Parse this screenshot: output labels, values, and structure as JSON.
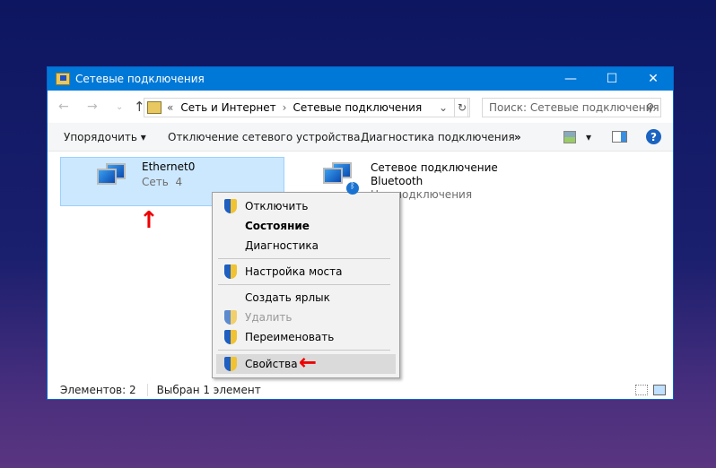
{
  "window": {
    "title": "Сетевые подключения",
    "minimize": "—",
    "maximize": "☐",
    "close": "✕"
  },
  "address": {
    "back": "←",
    "forward": "→",
    "recent": "⌄",
    "up": "↑",
    "overflow": "«",
    "crumbs": [
      "Сеть и Интернет",
      "Сетевые подключения"
    ],
    "sep": "›",
    "dropdown": "⌄",
    "refresh": "↻",
    "search_placeholder": "Поиск: Сетевые подключения",
    "search_icon": "⚲"
  },
  "toolbar": {
    "organize": "Упорядочить ▾",
    "disable": "Отключение сетевого устройства",
    "diagnose": "Диагностика подключения",
    "more": "»",
    "view_drop": "▾",
    "help": "?"
  },
  "items": [
    {
      "name": "Ethernet0",
      "sub": "Сеть  4"
    },
    {
      "name": "Сетевое подключение",
      "name2": "Bluetooth",
      "sub": "Нет подключения"
    }
  ],
  "menu": [
    {
      "label": "Отключить",
      "shield": true
    },
    {
      "label": "Состояние",
      "bold": true
    },
    {
      "label": "Диагностика"
    },
    {
      "label": "Настройка моста",
      "shield": true
    },
    {
      "label": "Создать ярлык"
    },
    {
      "label": "Удалить",
      "shield": true,
      "disabled": true
    },
    {
      "label": "Переименовать",
      "shield": true
    },
    {
      "label": "Свойства",
      "shield": true,
      "highlighted": true
    }
  ],
  "status": {
    "count": "Элементов: 2",
    "selected": "Выбран 1 элемент"
  },
  "annotations": {
    "up_arrow": "↑",
    "left_arrow": "←"
  }
}
